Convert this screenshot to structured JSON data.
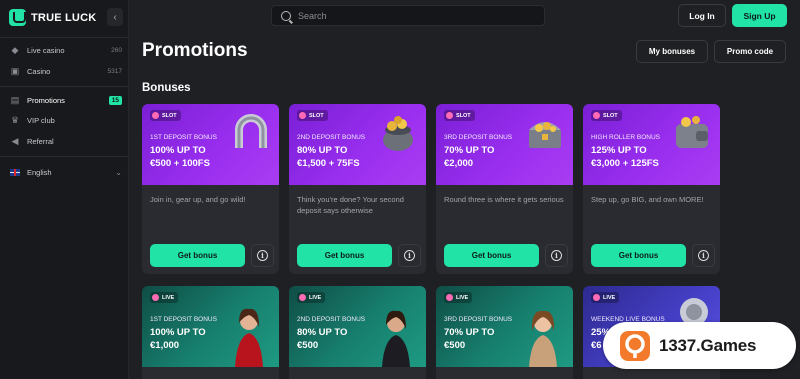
{
  "app": {
    "logo_text": "TRUE LUCK"
  },
  "sidebar": {
    "items": [
      {
        "label": "Live casino",
        "count": "260"
      },
      {
        "label": "Casino",
        "count": "5317"
      },
      {
        "label": "Promotions",
        "badge": "15"
      },
      {
        "label": "VIP club"
      },
      {
        "label": "Referral"
      },
      {
        "label": "English"
      }
    ]
  },
  "header": {
    "search_placeholder": "Search",
    "login_label": "Log In",
    "signup_label": "Sign Up"
  },
  "page": {
    "title": "Promotions",
    "my_bonuses_label": "My bonuses",
    "promo_code_label": "Promo code",
    "section_title": "Bonuses"
  },
  "cards": [
    {
      "tag": "SLOT",
      "subtitle": "1ST DEPOSIT BONUS",
      "headline_1": "100% UP TO",
      "headline_2": "€500 + 100FS",
      "description": "Join in, gear up, and go wild!",
      "button": "Get bonus"
    },
    {
      "tag": "SLOT",
      "subtitle": "2ND DEPOSIT BONUS",
      "headline_1": "80% UP TO",
      "headline_2": "€1,500 + 75FS",
      "description": "Think you're done? Your second deposit says otherwise",
      "button": "Get bonus"
    },
    {
      "tag": "SLOT",
      "subtitle": "3RD DEPOSIT BONUS",
      "headline_1": "70% UP TO",
      "headline_2": "€2,000",
      "description": "Round three is where it gets serious",
      "button": "Get bonus"
    },
    {
      "tag": "SLOT",
      "subtitle": "HIGH ROLLER BONUS",
      "headline_1": "125% UP TO",
      "headline_2": "€3,000 + 125FS",
      "description": "Step up, go BIG, and own MORE!",
      "button": "Get bonus"
    },
    {
      "tag": "LIVE",
      "subtitle": "1ST DEPOSIT BONUS",
      "headline_1": "100% UP TO",
      "headline_2": "€1,000"
    },
    {
      "tag": "LIVE",
      "subtitle": "2ND DEPOSIT BONUS",
      "headline_1": "80% UP TO",
      "headline_2": "€500"
    },
    {
      "tag": "LIVE",
      "subtitle": "3RD DEPOSIT BONUS",
      "headline_1": "70% UP TO",
      "headline_2": "€500"
    },
    {
      "tag": "LIVE",
      "subtitle": "WEEKEND LIVE BONUS",
      "headline_1": "25%",
      "headline_2": "€6"
    }
  ],
  "watermark": {
    "text": "1337.Games"
  },
  "colors": {
    "accent": "#20e3a5",
    "slot_banner": "#8a27e6",
    "live_banner": "#17806f",
    "background": "#1f2024"
  }
}
